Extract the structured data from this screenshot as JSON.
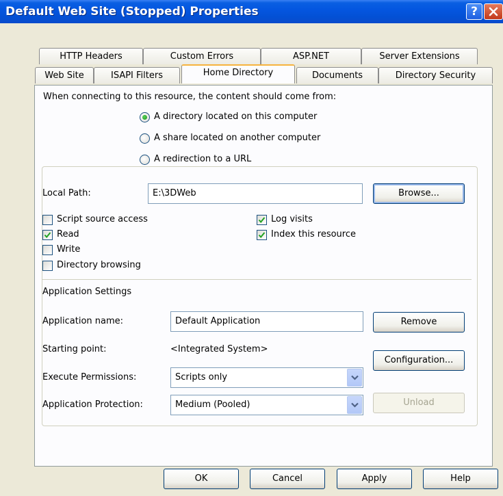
{
  "window": {
    "title": "Default Web Site (Stopped) Properties"
  },
  "titlebar": {
    "help_glyph": "?",
    "close_glyph": "X"
  },
  "tabs": {
    "row1": [
      "HTTP Headers",
      "Custom Errors",
      "ASP.NET",
      "Server Extensions"
    ],
    "row2": [
      "Web Site",
      "ISAPI Filters",
      "Home Directory",
      "Documents",
      "Directory Security"
    ],
    "active": "Home Directory"
  },
  "content_source": {
    "prompt": "When connecting to this resource, the content should come from:",
    "options": [
      {
        "label": "A directory located on this computer",
        "selected": true
      },
      {
        "label": "A share located on another computer",
        "selected": false
      },
      {
        "label": "A redirection to a URL",
        "selected": false
      }
    ]
  },
  "local_path": {
    "label": "Local Path:",
    "value": "E:\\3DWeb",
    "browse_label": "Browse..."
  },
  "permissions": [
    {
      "label": "Script source access",
      "checked": false
    },
    {
      "label": "Read",
      "checked": true
    },
    {
      "label": "Write",
      "checked": false
    },
    {
      "label": "Directory browsing",
      "checked": false
    },
    {
      "label": "Log visits",
      "checked": true
    },
    {
      "label": "Index this resource",
      "checked": true
    }
  ],
  "app_settings": {
    "heading": "Application Settings",
    "name_label": "Application name:",
    "name_value": "Default Application",
    "remove_label": "Remove",
    "start_label": "Starting point:",
    "start_value": "<Integrated System>",
    "config_label": "Configuration...",
    "exec_label": "Execute Permissions:",
    "exec_value": "Scripts only",
    "protection_label": "Application Protection:",
    "protection_value": "Medium (Pooled)",
    "unload_label": "Unload"
  },
  "footer": {
    "ok": "OK",
    "cancel": "Cancel",
    "apply": "Apply",
    "help": "Help"
  }
}
